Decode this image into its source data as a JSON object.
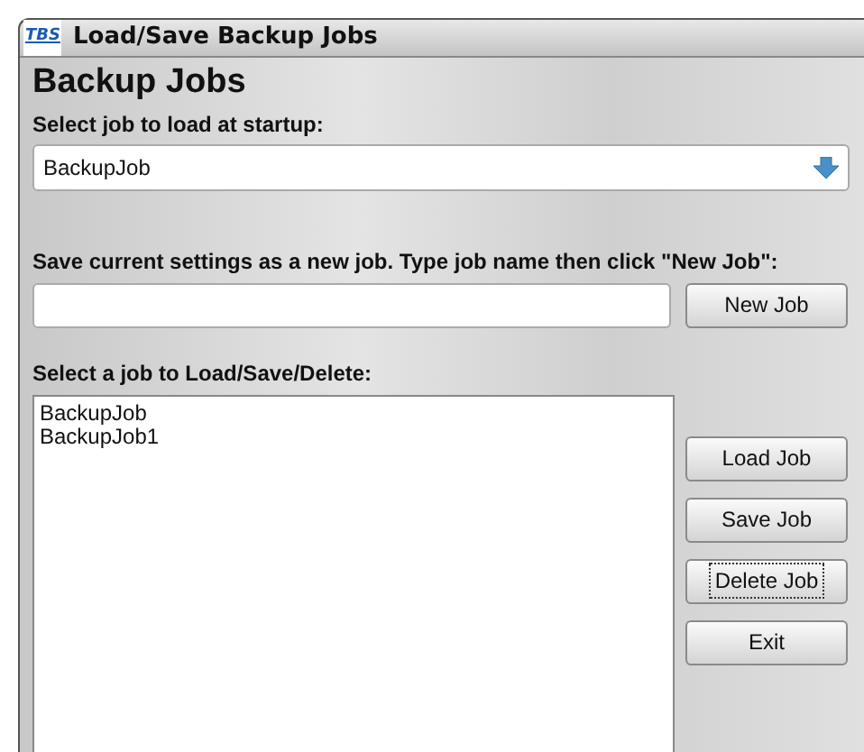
{
  "window": {
    "logo": "TBS",
    "title": "Load/Save Backup Jobs"
  },
  "heading": "Backup Jobs",
  "startup": {
    "label": "Select job to load at startup:",
    "value": "BackupJob"
  },
  "new_job": {
    "label": "Save current settings as a new job. Type job name then click \"New Job\":",
    "button": "New Job"
  },
  "jobs": {
    "label": "Select a job to Load/Save/Delete:",
    "items": [
      "BackupJob",
      "BackupJob1"
    ]
  },
  "buttons": [
    {
      "label": "Load Job",
      "focused": false
    },
    {
      "label": "Save Job",
      "focused": false
    },
    {
      "label": "Delete Job",
      "focused": true
    },
    {
      "label": "Exit",
      "focused": false
    }
  ]
}
